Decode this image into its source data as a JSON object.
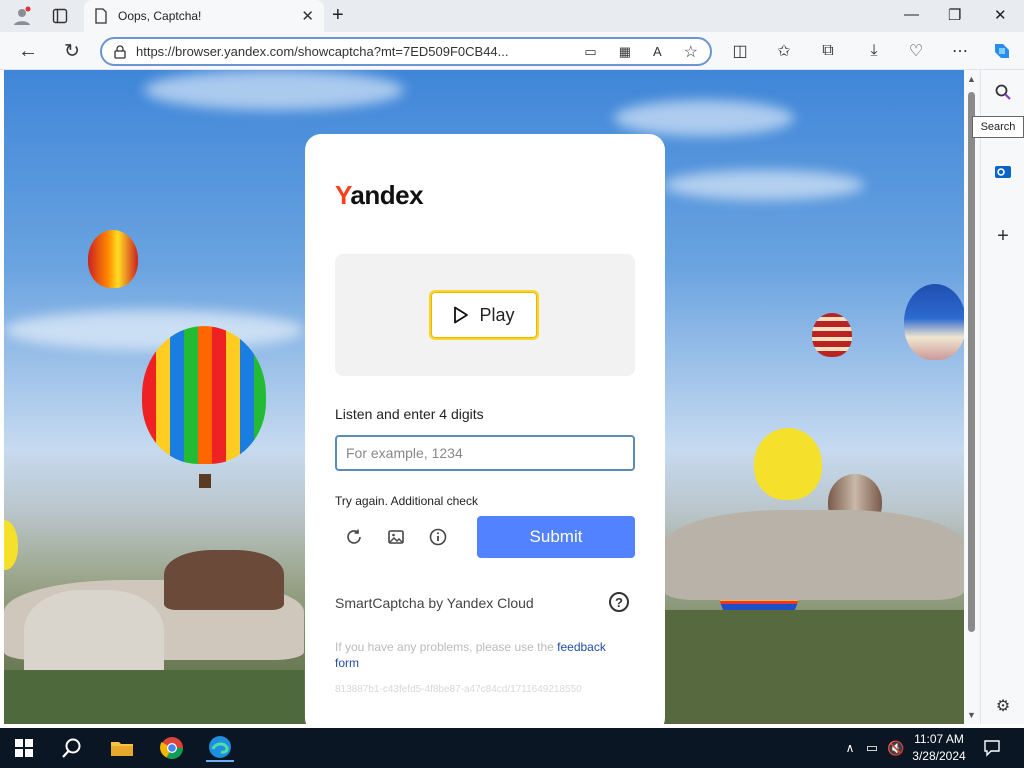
{
  "browser": {
    "tab_title": "Oops, Captcha!",
    "url": "https://browser.yandex.com/showcaptcha?mt=7ED509F0CB44...",
    "tooltip": "Search"
  },
  "captcha": {
    "logo": {
      "y": "Y",
      "rest": "andex"
    },
    "play_label": "Play",
    "instruction": "Listen and enter 4 digits",
    "input_placeholder": "For example, 1234",
    "input_value": "",
    "retry_text": "Try again. Additional check",
    "submit_label": "Submit",
    "provider": "SmartCaptcha by Yandex Cloud",
    "help_glyph": "?",
    "feedback_prefix": "If you have any problems, please use the",
    "feedback_link": "feedback form",
    "request_id": "813887b1-c43fefd5-4f8be87-a47c84cd/1711649218550"
  },
  "taskbar": {
    "time": "11:07 AM",
    "date": "3/28/2024"
  },
  "colors": {
    "accent": "#5282ff",
    "play_border": "#fed42b",
    "logo_y": "#fc3f1d"
  }
}
